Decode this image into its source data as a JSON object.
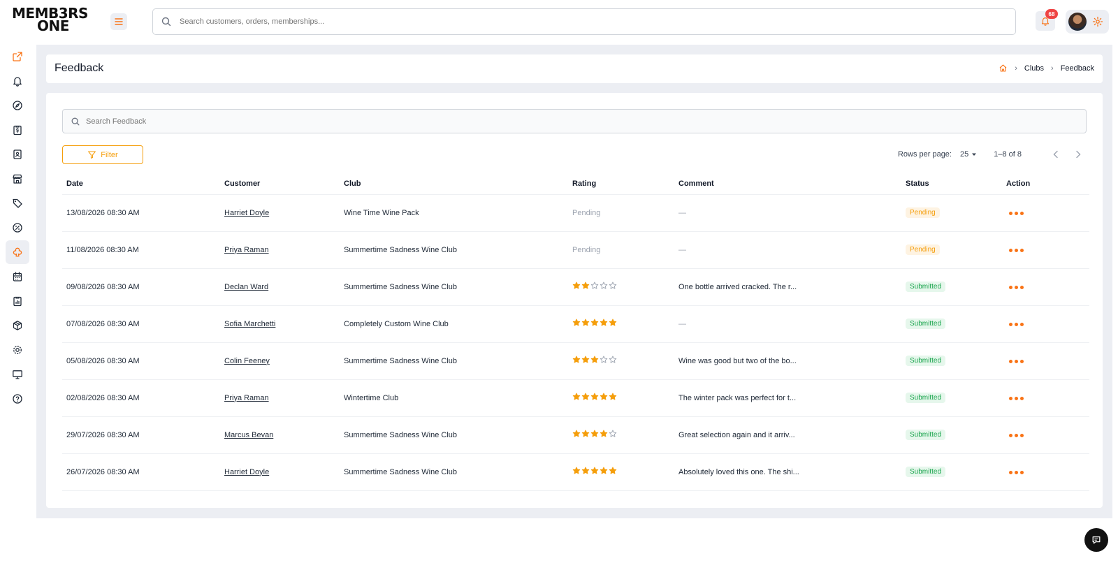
{
  "app": {
    "logo_line1": "MEMB3RS",
    "logo_line2": "ONE"
  },
  "topbar": {
    "search_placeholder": "Search customers, orders, memberships...",
    "notification_count": "68"
  },
  "sidebar": {
    "items": [
      {
        "icon": "external-link-icon"
      },
      {
        "icon": "bell-icon"
      },
      {
        "icon": "dashboard-gauge-icon"
      },
      {
        "icon": "clipboard-dollar-icon"
      },
      {
        "icon": "contacts-book-icon"
      },
      {
        "icon": "store-icon"
      },
      {
        "icon": "tag-icon"
      },
      {
        "icon": "discount-icon"
      },
      {
        "icon": "clubs-icon",
        "active": true
      },
      {
        "icon": "calendar-icon"
      },
      {
        "icon": "report-clipboard-icon"
      },
      {
        "icon": "package-icon"
      },
      {
        "icon": "settings-icon"
      },
      {
        "icon": "monitor-icon"
      },
      {
        "icon": "help-icon"
      }
    ]
  },
  "header": {
    "title": "Feedback",
    "breadcrumb": [
      "Clubs",
      "Feedback"
    ]
  },
  "main": {
    "search_placeholder": "Search Feedback",
    "filter_label": "Filter",
    "pagination": {
      "rows_per_page_label": "Rows per page:",
      "rows_per_page": "25",
      "range": "1–8 of 8"
    },
    "columns": [
      "Date",
      "Customer",
      "Club",
      "Rating",
      "Comment",
      "Status",
      "Action"
    ],
    "rows": [
      {
        "date": "13/08/2026 08:30 AM",
        "customer": "Harriet Doyle",
        "club": "Wine Time Wine Pack",
        "rating_text": "Pending",
        "rating": null,
        "comment": "—",
        "status": "Pending"
      },
      {
        "date": "11/08/2026 08:30 AM",
        "customer": "Priya Raman",
        "club": "Summertime Sadness Wine Club",
        "rating_text": "Pending",
        "rating": null,
        "comment": "—",
        "status": "Pending"
      },
      {
        "date": "09/08/2026 08:30 AM",
        "customer": "Declan Ward",
        "club": "Summertime Sadness Wine Club",
        "rating_text": "",
        "rating": 2,
        "comment": "One bottle arrived cracked. The r...",
        "status": "Submitted"
      },
      {
        "date": "07/08/2026 08:30 AM",
        "customer": "Sofia Marchetti",
        "club": "Completely Custom Wine Club",
        "rating_text": "",
        "rating": 5,
        "comment": "—",
        "status": "Submitted"
      },
      {
        "date": "05/08/2026 08:30 AM",
        "customer": "Colin Feeney",
        "club": "Summertime Sadness Wine Club",
        "rating_text": "",
        "rating": 3,
        "comment": "Wine was good but two of the bo...",
        "status": "Submitted"
      },
      {
        "date": "02/08/2026 08:30 AM",
        "customer": "Priya Raman",
        "club": "Wintertime Club",
        "rating_text": "",
        "rating": 5,
        "comment": "The winter pack was perfect for t...",
        "status": "Submitted"
      },
      {
        "date": "29/07/2026 08:30 AM",
        "customer": "Marcus Bevan",
        "club": "Summertime Sadness Wine Club",
        "rating_text": "",
        "rating": 4,
        "comment": "Great selection again and it arriv...",
        "status": "Submitted"
      },
      {
        "date": "26/07/2026 08:30 AM",
        "customer": "Harriet Doyle",
        "club": "Summertime Sadness Wine Club",
        "rating_text": "",
        "rating": 5,
        "comment": "Absolutely loved this one. The shi...",
        "status": "Submitted"
      }
    ]
  },
  "colors": {
    "accent": "#f59e0b",
    "action": "#f97316",
    "pending": "#f59e0b",
    "submitted": "#16a34a"
  }
}
